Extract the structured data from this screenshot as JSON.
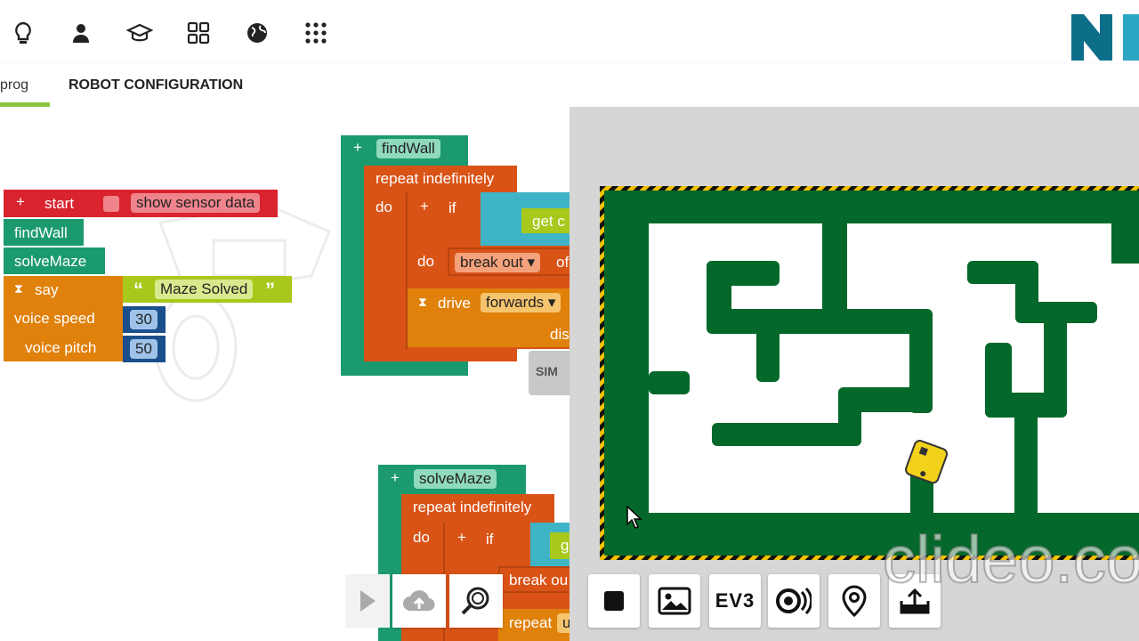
{
  "tabs": {
    "prog": "prog",
    "robot_config": "ROBOT CONFIGURATION"
  },
  "blocks": {
    "start": {
      "label": "start",
      "show_sensor": "show sensor data"
    },
    "find_wall_call": "findWall",
    "solve_maze_call": "solveMaze",
    "say": {
      "label": "say",
      "quote_open": "“",
      "text": "Maze Solved",
      "quote_close": "”"
    },
    "voice_speed": {
      "label": "voice speed",
      "value": "30"
    },
    "voice_pitch": {
      "label": "voice pitch",
      "value": "50"
    },
    "find_wall_def": {
      "name": "findWall",
      "repeat": "repeat indefinitely",
      "do": "do",
      "if": "if",
      "get": "get c",
      "do2": "do",
      "break_out": "break out",
      "of": "of",
      "drive": "drive",
      "forwards": "forwards",
      "dis": "dis"
    },
    "sim_tab": "SIM",
    "solve_maze_def": {
      "name": "solveMaze",
      "repeat": "repeat indefinitely",
      "do": "do",
      "if": "if",
      "get": "ge",
      "break_out": "break ou",
      "repeat2": "repeat",
      "u": "u"
    }
  },
  "sim_toolbar": {
    "ev3_label": "EV3"
  },
  "watermark": "clideo.co",
  "colors": {
    "maze_wall": "#04682a",
    "tab_accent": "#8cc63f",
    "logo": "#0d6e8a"
  }
}
